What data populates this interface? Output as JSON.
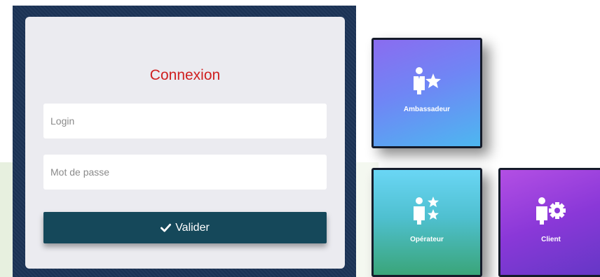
{
  "login": {
    "title": "Connexion",
    "login_placeholder": "Login",
    "password_placeholder": "Mot de passe",
    "submit_label": "Valider"
  },
  "tiles": [
    {
      "label": "Ambassadeur",
      "icon": "person-star-icon"
    },
    {
      "label": "Opérateur",
      "icon": "person-two-stars-icon"
    },
    {
      "label": "Client",
      "icon": "person-gear-icon"
    }
  ],
  "colors": {
    "title_red": "#cf1f1f",
    "button_teal": "#15485a",
    "frame_navy": "#1c3457"
  }
}
